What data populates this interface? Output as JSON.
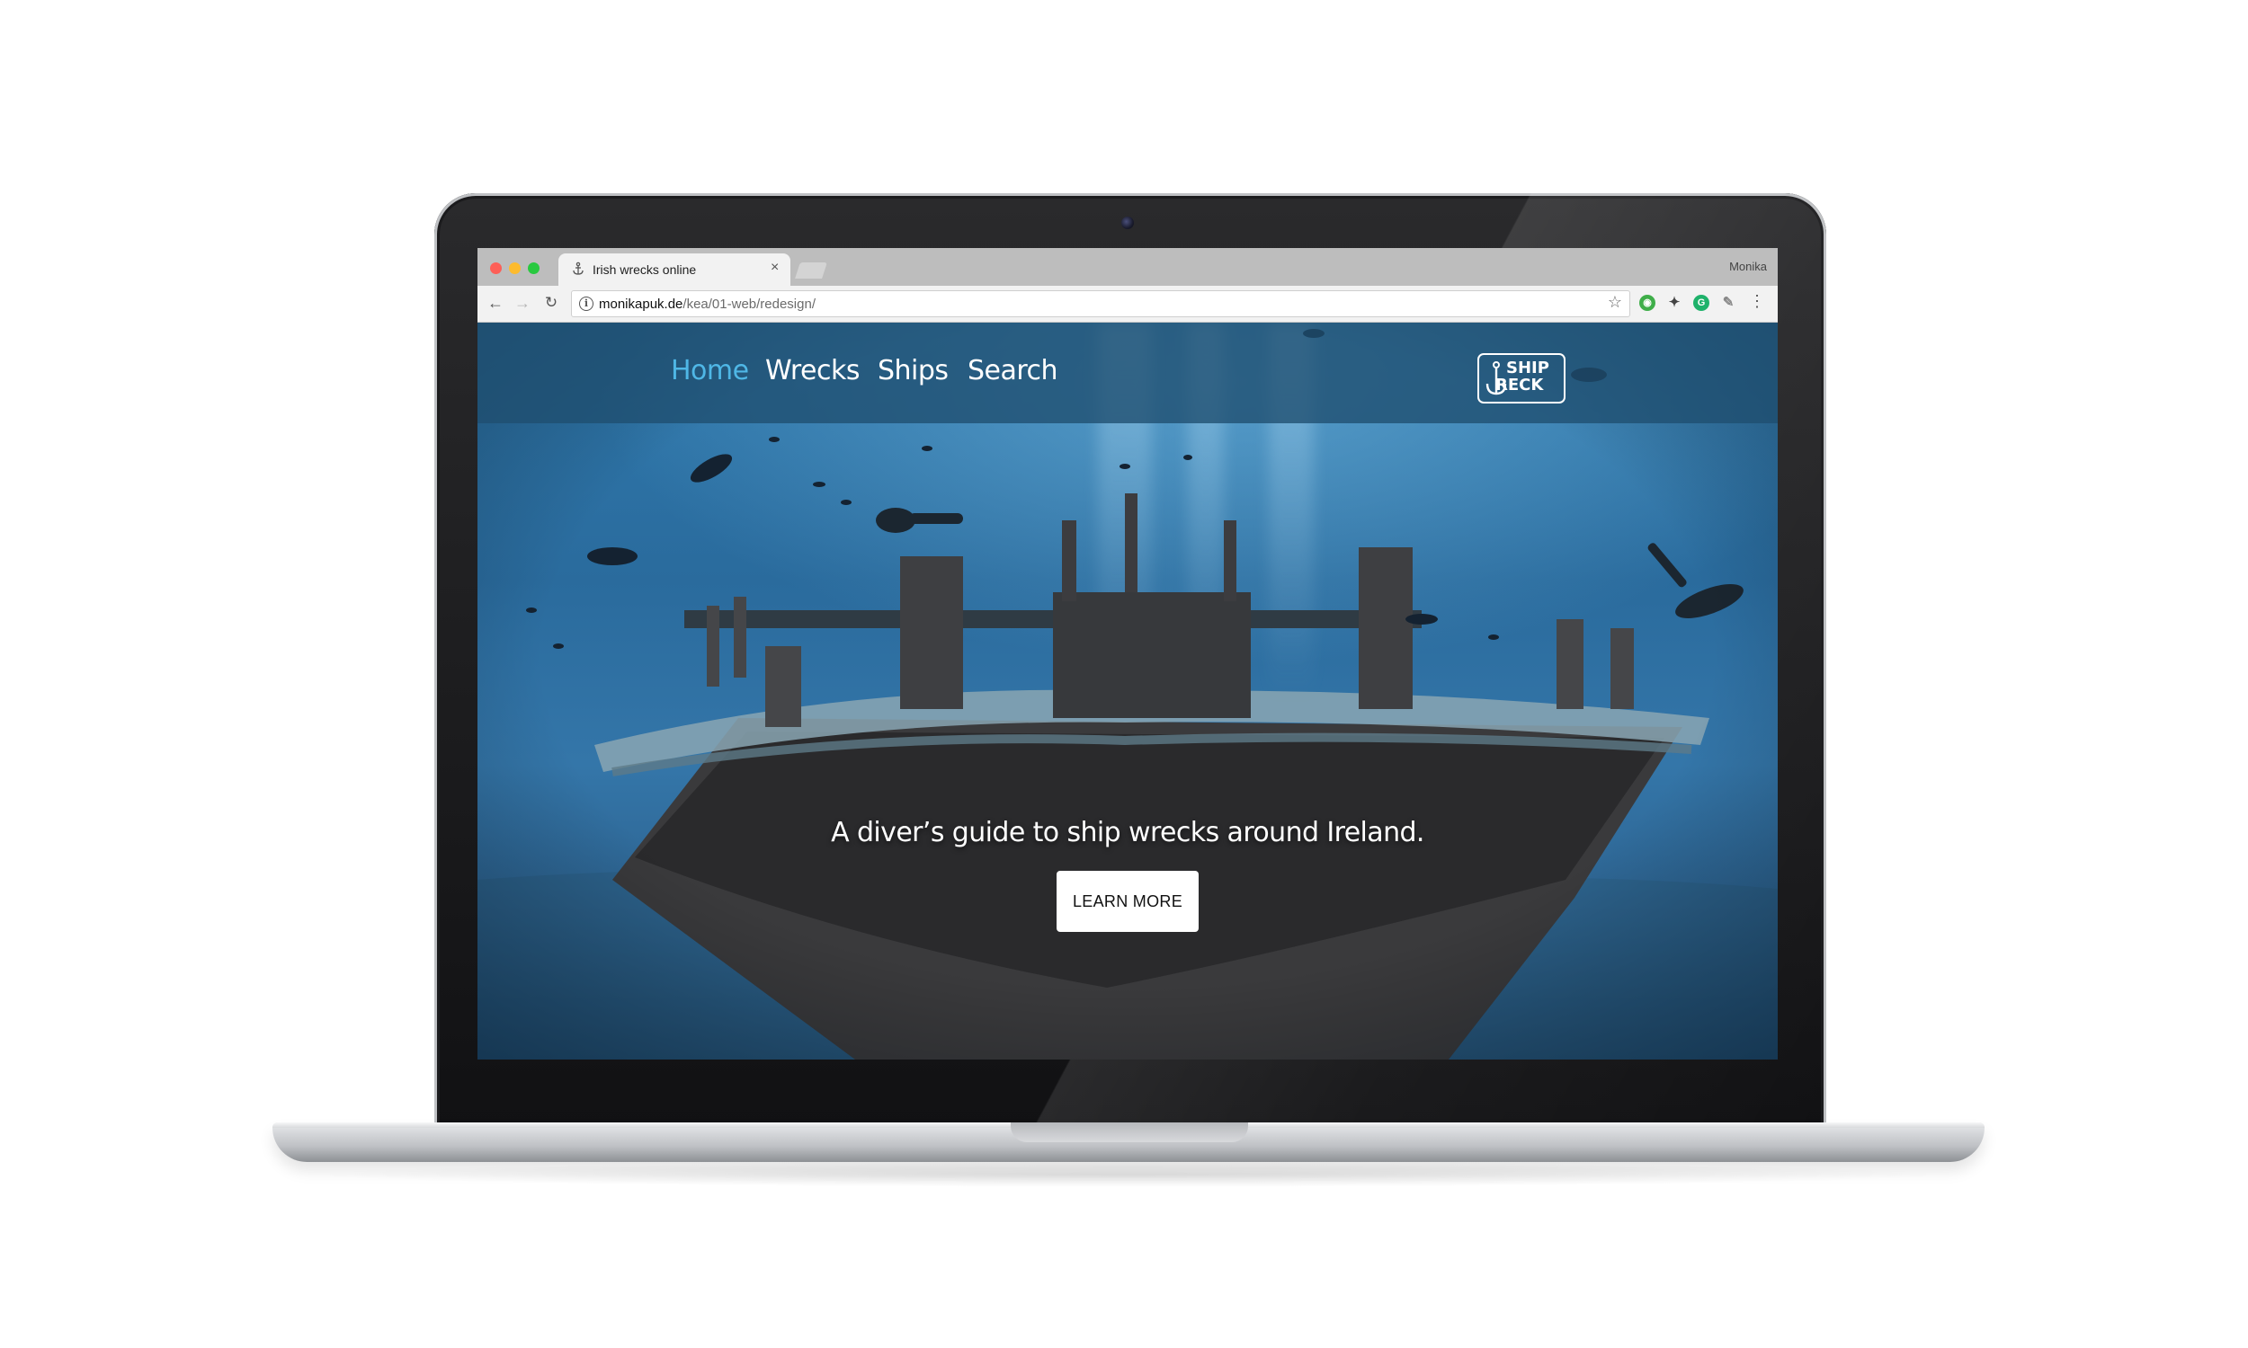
{
  "browser": {
    "tab_title": "Irish wrecks online",
    "profile_name": "Monika",
    "url_host": "monikapuk.de",
    "url_path": "/kea/01-web/redesign/",
    "icons": {
      "tab": "anchor-icon",
      "close": "close-icon",
      "back": "back-arrow-icon",
      "forward": "forward-arrow-icon",
      "reload": "reload-icon",
      "info": "info-icon",
      "bookmark": "star-icon",
      "menu": "kebab-menu-icon"
    },
    "traffic_light_colors": [
      "#fd5f57",
      "#fdbb2e",
      "#29c940"
    ]
  },
  "site": {
    "nav": [
      {
        "label": "Home",
        "active": true
      },
      {
        "label": "Wrecks",
        "active": false
      },
      {
        "label": "Ships",
        "active": false
      },
      {
        "label": "Search",
        "active": false
      }
    ],
    "logo": {
      "line1": "SHIP",
      "line2": "RECK"
    },
    "hero": {
      "tagline": "A diver’s guide to ship wrecks around Ireland.",
      "button_label": "LEARN MORE"
    },
    "colors": {
      "active_nav": "#4fb7e6",
      "navbar_bg": "#1f4e70",
      "button_bg": "#ffffff"
    }
  }
}
